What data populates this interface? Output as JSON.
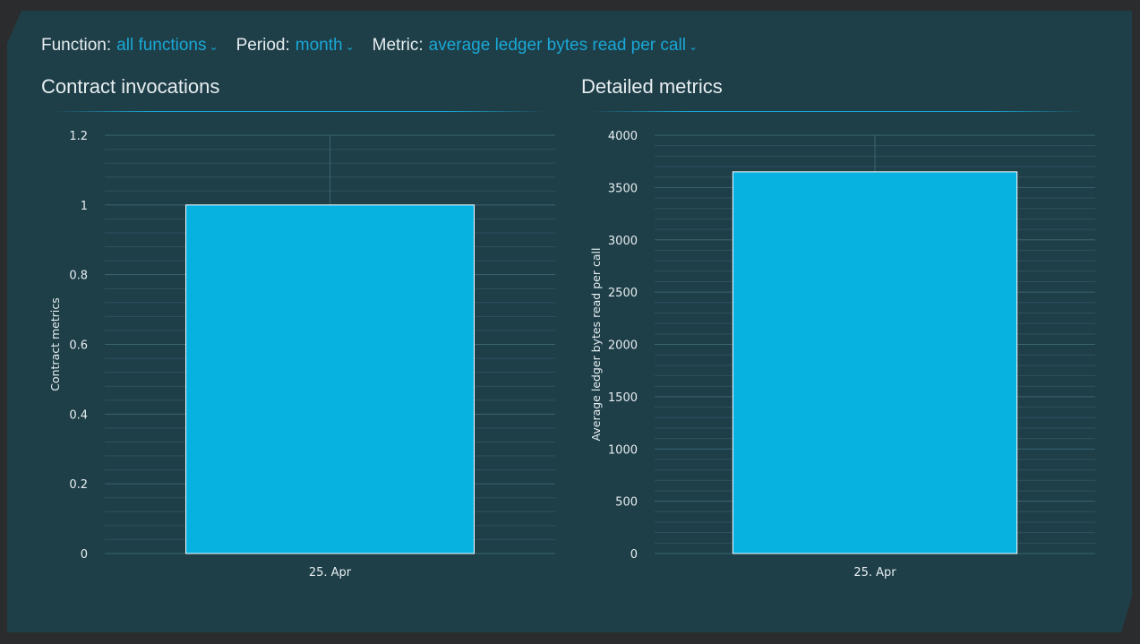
{
  "filters": {
    "function_label": "Function:",
    "function_value": "all functions",
    "period_label": "Period:",
    "period_value": "month",
    "metric_label": "Metric:",
    "metric_value": "average ledger bytes read per call"
  },
  "sections": {
    "left_title": "Contract invocations",
    "right_title": "Detailed metrics"
  },
  "colors": {
    "bar": "#08b2e0",
    "accent": "#1aa8d6",
    "panel": "#1e3e48"
  },
  "chart_data": [
    {
      "type": "bar",
      "title": "Contract invocations",
      "categories": [
        "25. Apr"
      ],
      "values": [
        1
      ],
      "xlabel": "",
      "ylabel": "Contract metrics",
      "ylim": [
        0,
        1.2
      ],
      "yticks": [
        0,
        0.2,
        0.4,
        0.6,
        0.8,
        1,
        1.2
      ],
      "ytick_labels": [
        "0",
        "0.2",
        "0.4",
        "0.6",
        "0.8",
        "1",
        "1.2"
      ],
      "grid": true
    },
    {
      "type": "bar",
      "title": "Detailed metrics",
      "categories": [
        "25. Apr"
      ],
      "values": [
        3650
      ],
      "xlabel": "",
      "ylabel": "Average ledger bytes read per call",
      "ylim": [
        0,
        4000
      ],
      "yticks": [
        0,
        500,
        1000,
        1500,
        2000,
        2500,
        3000,
        3500,
        4000
      ],
      "ytick_labels": [
        "0",
        "500",
        "1000",
        "1500",
        "2000",
        "2500",
        "3000",
        "3500",
        "4000"
      ],
      "grid": true
    }
  ]
}
